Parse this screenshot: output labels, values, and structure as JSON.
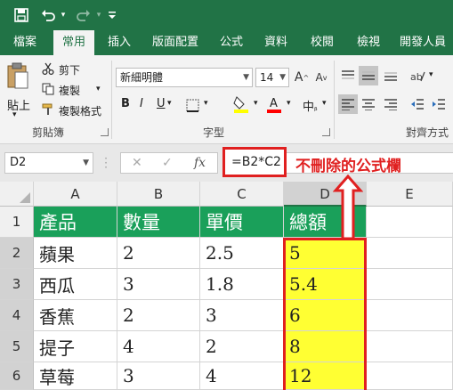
{
  "qat": {
    "save": "save-icon",
    "undo": "undo-icon",
    "redo": "redo-icon",
    "more": "more-icon"
  },
  "tabs": [
    "檔案",
    "常用",
    "插入",
    "版面配置",
    "公式",
    "資料",
    "校閱",
    "檢視",
    "開發人員"
  ],
  "ribbon": {
    "paste": "貼上",
    "cut": "剪下",
    "copy": "複製",
    "format_painter": "複製格式",
    "clipboard_group": "剪貼簿",
    "font_name": "新細明體",
    "font_size": "14",
    "font_group": "字型",
    "align_group": "對齊方式",
    "bold": "B",
    "italic": "I",
    "underline": "U"
  },
  "formula_bar": {
    "name_box": "D2",
    "fx": "fx",
    "formula": "=B2*C2"
  },
  "annotation": {
    "text": "不刪除的公式欄"
  },
  "sheet": {
    "columns": [
      "A",
      "B",
      "C",
      "D",
      "E"
    ],
    "rows": [
      "1",
      "2",
      "3",
      "4",
      "5",
      "6"
    ],
    "header": [
      "產品",
      "數量",
      "單價",
      "總額"
    ],
    "data": [
      [
        "蘋果",
        "2",
        "2.5",
        "5"
      ],
      [
        "西瓜",
        "3",
        "1.8",
        "5.4"
      ],
      [
        "香蕉",
        "2",
        "3",
        "6"
      ],
      [
        "提子",
        "4",
        "2",
        "8"
      ],
      [
        "草莓",
        "3",
        "4",
        "12"
      ]
    ]
  },
  "colors": {
    "excel_green": "#217346",
    "header_fill": "#1aa05a",
    "highlight": "#ffff33",
    "annotation": "#e02020"
  }
}
